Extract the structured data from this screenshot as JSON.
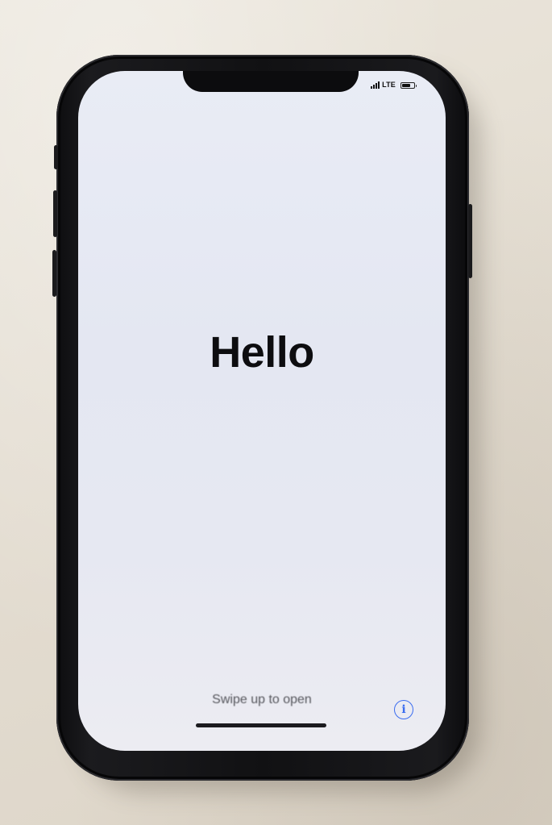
{
  "lock_screen": {
    "greeting": "Hello",
    "swipe_hint": "Swipe up to open"
  },
  "status_bar": {
    "network": "LTE",
    "signal_bars": 4,
    "battery_level": 0.75
  },
  "icons": {
    "info": "info-icon",
    "signal": "cellular-signal-icon",
    "battery": "battery-icon"
  },
  "colors": {
    "accent": "#3a6cf0",
    "screen": "#e7e9f3",
    "text": "#0d0d10"
  }
}
